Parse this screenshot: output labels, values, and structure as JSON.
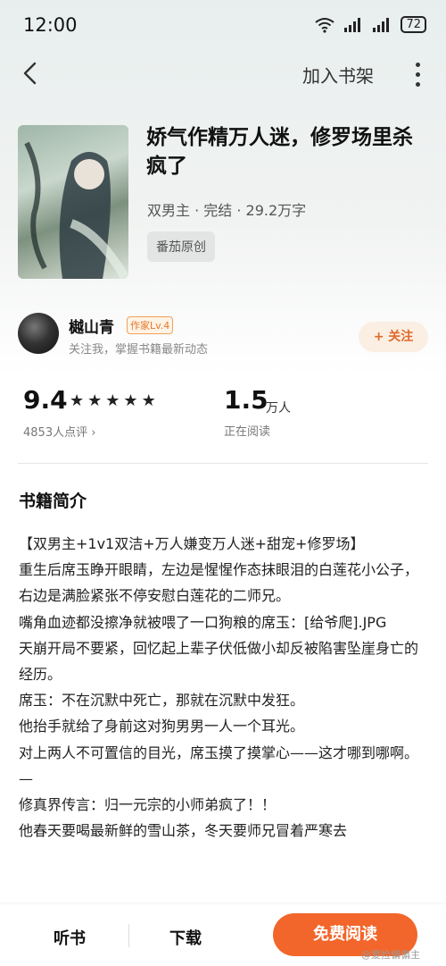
{
  "status_bar": {
    "time": "12:00",
    "battery": "72"
  },
  "nav": {
    "add_to_shelf": "加入书架"
  },
  "book": {
    "title": "娇气作精万人迷，修罗场里杀疯了",
    "meta": "双男主 · 完结 · 29.2万字",
    "publisher": "番茄原创"
  },
  "author": {
    "name": "樾山青",
    "level": "作家Lv.4",
    "desc": "关注我，掌握书籍最新动态",
    "follow_label": "+ 关注"
  },
  "stats": {
    "score": "9.4",
    "stars": 5,
    "reviews": "4853人点评 ›",
    "readers": "1.5",
    "readers_unit": "万人",
    "reading_label": "正在阅读"
  },
  "intro": {
    "title": "书籍简介",
    "lines": [
      "【双男主+1v1双洁+万人嫌变万人迷+甜宠+修罗场】",
      "重生后席玉睁开眼睛，左边是惺惺作态抹眼泪的白莲花小公子，右边是满脸紧张不停安慰白莲花的二师兄。",
      "嘴角血迹都没擦净就被喂了一口狗粮的席玉：[给爷爬].JPG",
      "天崩开局不要紧，回忆起上辈子伏低做小却反被陷害坠崖身亡的经历。",
      "席玉：不在沉默中死亡，那就在沉默中发狂。",
      "他抬手就给了身前这对狗男男一人一个耳光。",
      "对上两人不可置信的目光，席玉摸了摸掌心——这才哪到哪啊。",
      "—",
      "修真界传言：归一元宗的小师弟疯了！！",
      "他春天要喝最新鲜的雪山茶，冬天要师兄冒着严寒去"
    ]
  },
  "bottom": {
    "listen": "听书",
    "download": "下载",
    "read": "免费阅读",
    "watermark": "@爱捡偏偏主"
  }
}
